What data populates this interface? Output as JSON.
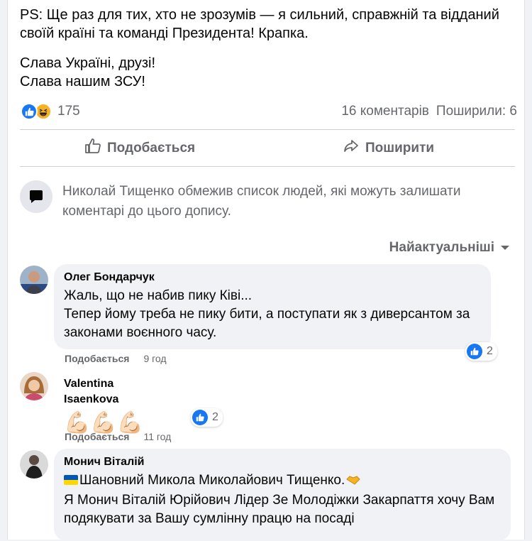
{
  "post": {
    "ps_line": "PS: Ще раз для тих, хто не зрозумів — я сильний, справжній та відданий своїй країні та команді Президента! Крапка.",
    "closing_line1": "Слава Україні, друзі!",
    "closing_line2": "Слава нашим ЗСУ!"
  },
  "stats": {
    "reactions_count": "175",
    "comments": "16 коментарів",
    "shares": "Поширили: 6"
  },
  "actions": {
    "like_label": "Подобається",
    "share_label": "Поширити"
  },
  "restriction_notice": "Николай Тищенко обмежив список людей, які можуть залишати коментарі до цього допису.",
  "sort_label": "Найактуальніші",
  "comments": [
    {
      "author": "Олег Бондарчук",
      "line1": "Жаль, що не набив пику Ківі...",
      "line2": "Тепер йому треба не пику бити, а поступати як з диверсантом за законами воєнного часу.",
      "like_label": "Подобається",
      "time": "9 год",
      "reactions": "2"
    },
    {
      "author": "Valentina Isaenkova",
      "text": "💪🏻💪🏻💪🏻",
      "like_label": "Подобається",
      "time": "11 год",
      "reactions": "2"
    },
    {
      "author": "Монич Віталій",
      "line1": "Шановний Микола Миколайович Тищенко.",
      "line2": "Я Монич Віталій Юрійович Лідер Зе Молодіжки Закарпаття хочу Вам подякувати за Вашу сумлінну працю на посаді"
    }
  ],
  "colors": {
    "accent": "#1877f2",
    "muted_text": "#65676b",
    "bubble_bg": "#f0f2f5"
  }
}
